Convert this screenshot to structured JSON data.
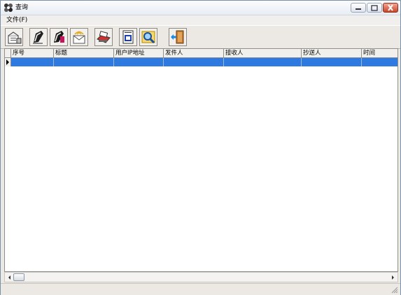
{
  "window": {
    "title": "查询",
    "controls": [
      "minimize",
      "maximize",
      "close"
    ]
  },
  "menu": {
    "file": "文件(F)"
  },
  "toolbar": {
    "buttons": [
      {
        "name": "open-mail-icon"
      },
      {
        "name": "write-icon"
      },
      {
        "name": "edit-icon"
      },
      {
        "name": "send-receive-icon"
      },
      {
        "name": "print-icon"
      },
      {
        "name": "address-book-icon"
      },
      {
        "name": "search-icon"
      },
      {
        "name": "exit-door-icon"
      }
    ]
  },
  "table": {
    "columns": [
      "序号",
      "标题",
      "用户IP地址",
      "发件人",
      "接收人",
      "抄送人",
      "时间"
    ],
    "rows": [
      [
        "",
        "",
        "",
        "",
        "",
        "",
        ""
      ]
    ]
  },
  "colors": {
    "selection": "#2f7ae0",
    "window_bg": "#ece9e4",
    "close_button": "#c9462a"
  }
}
